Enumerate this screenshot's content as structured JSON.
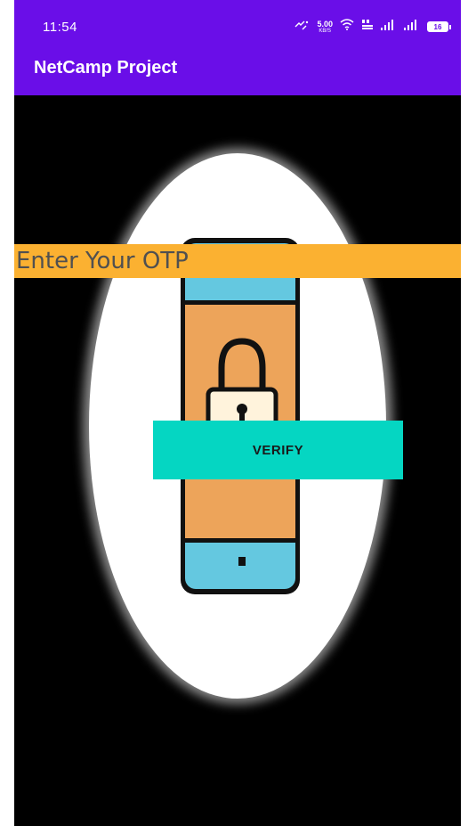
{
  "status_bar": {
    "time": "11:54",
    "net_speed_value": "5.00",
    "net_speed_unit": "KB/S",
    "wifi_label": "Vo LTE",
    "battery": "16",
    "icons": [
      "data-transfer-icon",
      "wifi-icon",
      "volte-icon",
      "signal-icon",
      "signal-icon",
      "battery-icon"
    ]
  },
  "app_bar": {
    "title": "NetCamp Project"
  },
  "otp": {
    "placeholder": "Enter Your OTP",
    "value": ""
  },
  "verify_button": {
    "label": "VERIFY"
  },
  "illustration": {
    "name": "phone-lock-icon"
  },
  "colors": {
    "app_bar": "#6a0ee8",
    "background": "#000000",
    "otp_field": "#fbb131",
    "verify_button": "#05d6c2",
    "phone_body": "#eda45a",
    "phone_screen_accent": "#64c8e0"
  }
}
